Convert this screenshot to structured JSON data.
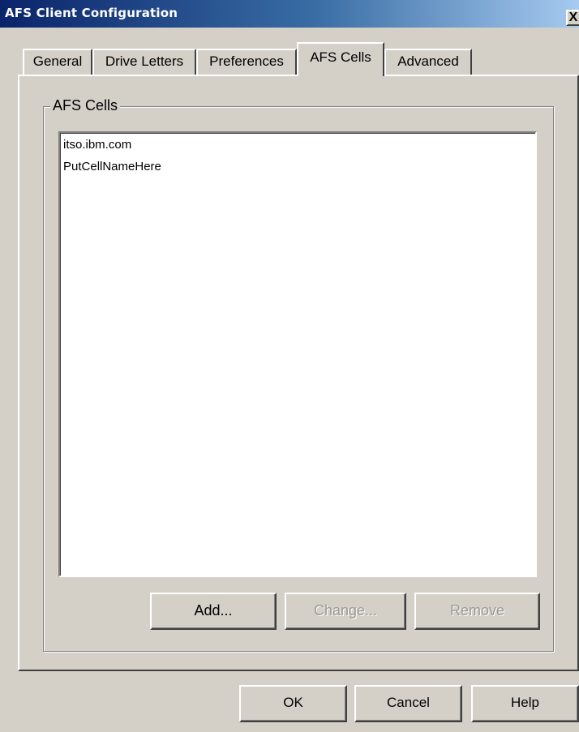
{
  "window": {
    "title": "AFS Client Configuration",
    "close_glyph": "X"
  },
  "tabs": [
    {
      "label": "General",
      "active": false
    },
    {
      "label": "Drive Letters",
      "active": false
    },
    {
      "label": "Preferences",
      "active": false
    },
    {
      "label": "AFS Cells",
      "active": true
    },
    {
      "label": "Advanced",
      "active": false
    }
  ],
  "group": {
    "label": "AFS Cells",
    "items": [
      "itso.ibm.com",
      "PutCellNameHere"
    ],
    "buttons": {
      "add": "Add...",
      "change": "Change...",
      "remove": "Remove"
    }
  },
  "footer": {
    "ok": "OK",
    "cancel": "Cancel",
    "help": "Help"
  },
  "icons": {
    "close": "close-icon"
  },
  "colors": {
    "face": "#d4d0c8",
    "title_start": "#0a246a",
    "title_end": "#a6caf0"
  }
}
